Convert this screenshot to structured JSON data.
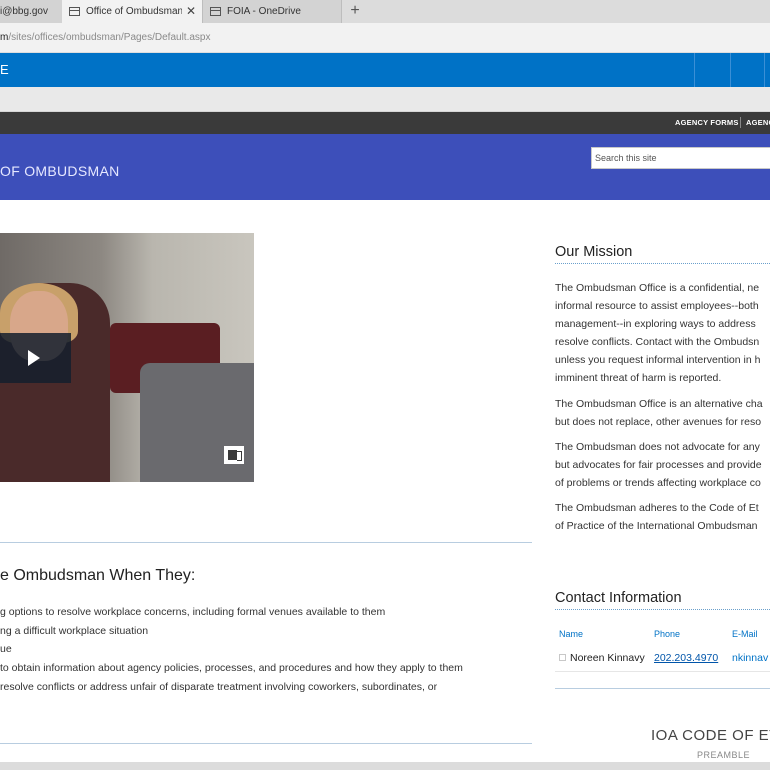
{
  "browser": {
    "tabs": [
      {
        "label": "i@bbg.gov",
        "active": false
      },
      {
        "label": "Office of Ombudsman H",
        "active": true
      },
      {
        "label": "FOIA - OneDrive",
        "active": false
      }
    ],
    "new_tab_glyph": "+",
    "close_glyph": "✕",
    "url_host": "m",
    "url_path": "/sites/offices/ombudsman/Pages/Default.aspx"
  },
  "suite_bar": {
    "mark": "E",
    "color": "#0072c6"
  },
  "global_nav": {
    "links": [
      "AGENCY FORMS",
      "AGENC"
    ]
  },
  "site_header": {
    "title": "OF OMBUDSMAN",
    "search_placeholder": "Search this site",
    "color": "#3d4fba"
  },
  "video": {
    "play_icon": "play-icon",
    "logo_icon": "video-logo-icon"
  },
  "contact_section": {
    "heading": "e Ombudsman When They:",
    "items": [
      "g options to resolve workplace concerns, including formal venues available to them",
      "ng a difficult workplace situation",
      "ue",
      " to obtain information about agency policies, processes, and procedures and how they apply to them",
      "resolve conflicts or address unfair of disparate treatment involving coworkers, subordinates, or"
    ]
  },
  "mission": {
    "heading": "Our Mission",
    "p1": [
      "The Ombudsman Office is a confidential, ne",
      "informal resource to assist employees--both",
      "management--in exploring ways to address",
      "resolve conflicts. Contact with the Ombudsn",
      "unless you request informal intervention in h",
      "imminent threat of harm is reported."
    ],
    "p2": [
      "The Ombudsman Office is an alternative cha",
      "but does not replace, other avenues for reso"
    ],
    "p3": [
      "The  Ombudsman does not advocate for any",
      "but advocates for fair processes and provide",
      "of problems or trends affecting workplace co"
    ],
    "p4": [
      "The Ombudsman adheres to the Code of Et",
      "of Practice of the International Ombudsman"
    ]
  },
  "contact_info": {
    "heading": "Contact Information",
    "columns": [
      "Name",
      "Phone",
      "E-Mail"
    ],
    "rows": [
      {
        "name": "Noreen Kinnavy",
        "phone": "202.203.4970",
        "email": "nkinnav"
      }
    ]
  },
  "ioa": {
    "title": "IOA CODE OF ET",
    "subtitle": "PREAMBLE"
  }
}
